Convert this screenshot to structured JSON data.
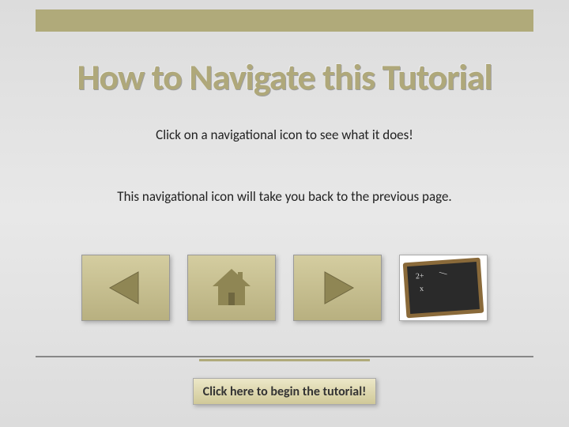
{
  "title": "How to Navigate this Tutorial",
  "subtitle": "Click on a navigational icon to see what it does!",
  "description": "This navigational icon will take you back to the previous page.",
  "icons": {
    "back": "back-arrow",
    "home": "home",
    "forward": "forward-arrow",
    "lesson": "chalkboard"
  },
  "begin_label": "Click here to begin the tutorial!",
  "colors": {
    "accent": "#b0aa7a",
    "card_top": "#d4cda0",
    "card_bottom": "#b8b080"
  }
}
